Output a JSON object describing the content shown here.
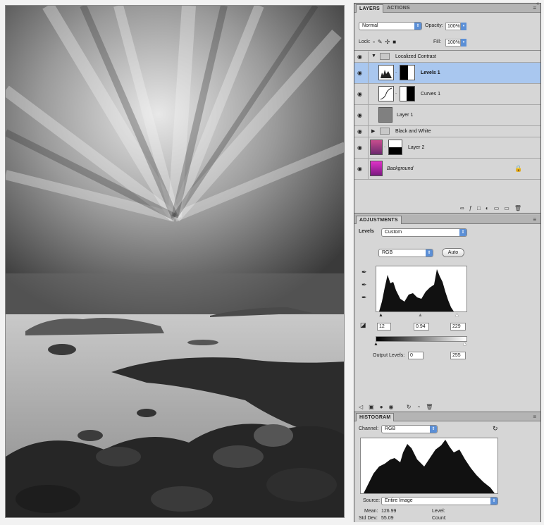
{
  "layers_panel": {
    "tabs": [
      "LAYERS",
      "ACTIONS"
    ],
    "blend_mode": "Normal",
    "opacity_label": "Opacity:",
    "opacity_value": "100%",
    "lock_label": "Lock:",
    "fill_label": "Fill:",
    "fill_value": "100%",
    "layers": [
      {
        "name": "Localized Contrast",
        "type": "group",
        "expanded": true
      },
      {
        "name": "Levels 1",
        "type": "adjustment",
        "selected": true
      },
      {
        "name": "Curves 1",
        "type": "adjustment"
      },
      {
        "name": "Layer 1",
        "type": "pixel"
      },
      {
        "name": "Black and White",
        "type": "group",
        "expanded": false
      },
      {
        "name": "Layer 2",
        "type": "pixel-masked"
      },
      {
        "name": "Background",
        "type": "background",
        "locked": true
      }
    ]
  },
  "adjustments_panel": {
    "tab": "ADJUSTMENTS",
    "title": "Levels",
    "preset": "Custom",
    "channel": "RGB",
    "auto_label": "Auto",
    "input_black": "12",
    "input_gamma": "0.94",
    "input_white": "229",
    "output_label": "Output Levels:",
    "output_black": "0",
    "output_white": "255"
  },
  "histogram_panel": {
    "tab": "HISTOGRAM",
    "channel_label": "Channel:",
    "channel": "RGB",
    "source_label": "Source:",
    "source": "Entire Image",
    "mean_label": "Mean:",
    "mean_value": "126.99",
    "level_label": "Level:",
    "stddev_label": "Std Dev:",
    "stddev_value": "55.09",
    "count_label": "Count:"
  },
  "colors": {
    "panel_bg": "#d6d6d6",
    "selection": "#a9c7ef",
    "accent_blue": "#5b8fd6"
  }
}
